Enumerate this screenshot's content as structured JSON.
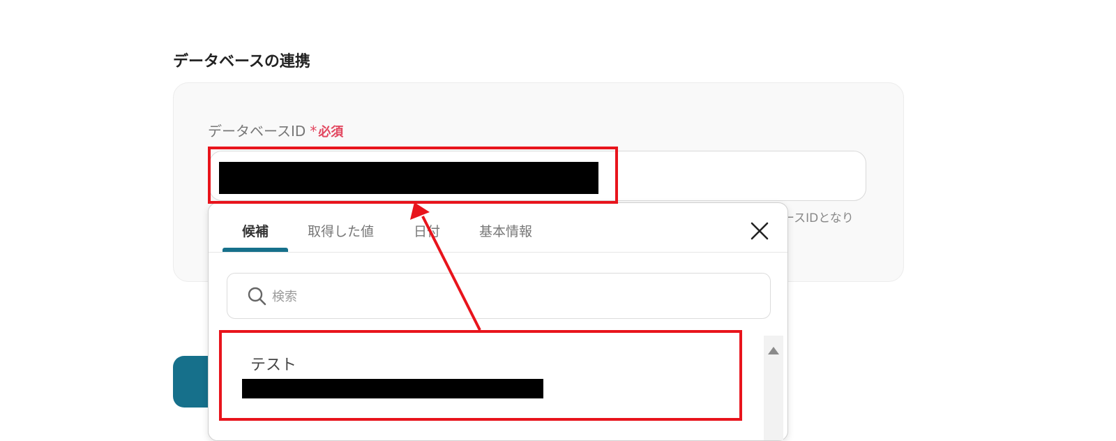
{
  "section": {
    "title": "データベースの連携"
  },
  "field": {
    "label": "データベースID",
    "required_star": "*",
    "required_text": "必須",
    "hint": "ースIDとなり"
  },
  "popover": {
    "tabs": [
      {
        "label": "候補",
        "active": true
      },
      {
        "label": "取得した値",
        "active": false
      },
      {
        "label": "日付",
        "active": false
      },
      {
        "label": "基本情報",
        "active": false
      }
    ],
    "close_icon": "close-icon",
    "search": {
      "placeholder": "検索",
      "icon": "search-icon"
    },
    "items": [
      {
        "label": "テスト"
      }
    ]
  },
  "colors": {
    "accent": "#16708b",
    "required": "#e2475f",
    "annotation": "#e8141c"
  }
}
